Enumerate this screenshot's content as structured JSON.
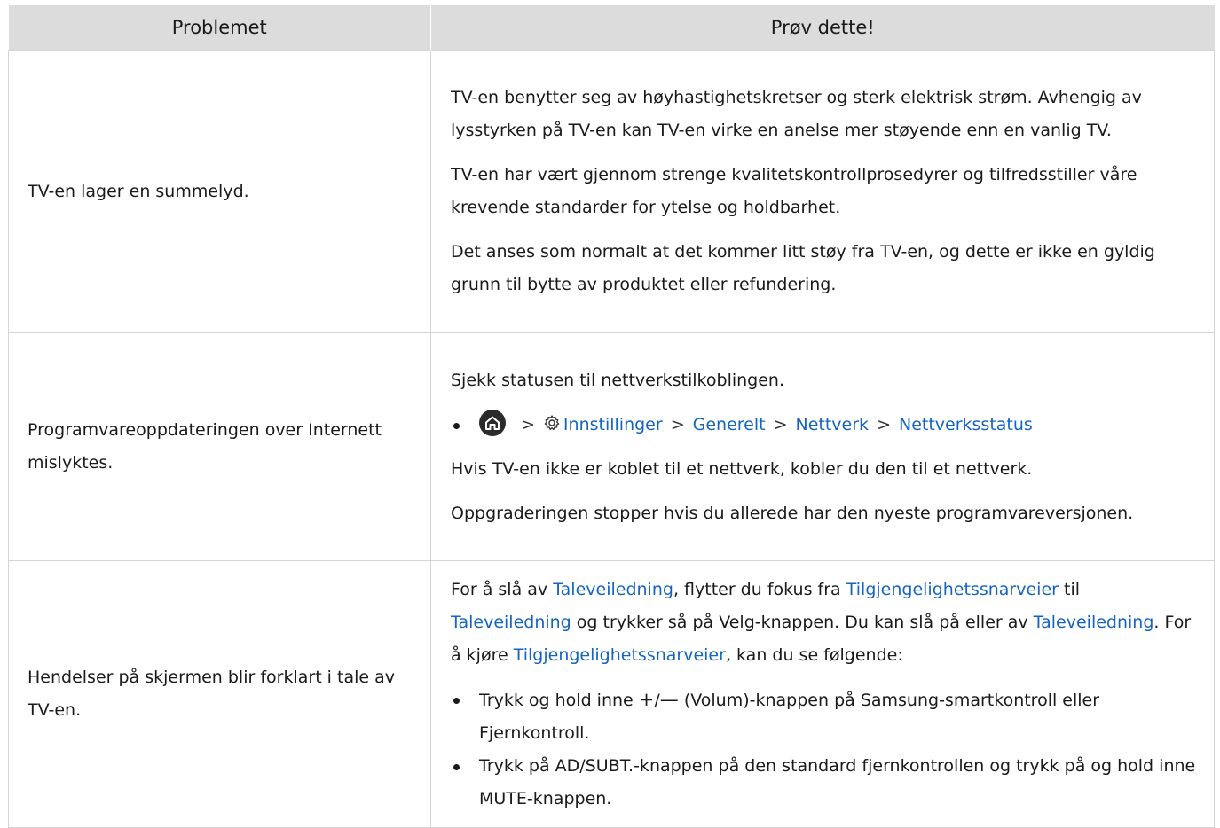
{
  "table": {
    "headers": [
      "Problemet",
      "Prøv dette!"
    ],
    "rows": [
      {
        "problem": "TV-en lager en summelyd.",
        "solution": {
          "p1": "TV-en benytter seg av høyhastighetskretser og sterk elektrisk strøm. Avhengig av lysstyrken på TV-en kan TV-en virke en anelse mer støyende enn en vanlig TV.",
          "p2": "TV-en har vært gjennom strenge kvalitetskontrollprosedyrer og tilfredsstiller våre krevende standarder for ytelse og holdbarhet.",
          "p3": "Det anses som normalt at det kommer litt støy fra TV-en, og dette er ikke en gyldig grunn til bytte av produktet eller refundering."
        }
      },
      {
        "problem": "Programvareoppdateringen over Internett mislyktes.",
        "solution": {
          "p1": "Sjekk statusen til nettverkstilkoblingen.",
          "path": {
            "home_icon": "home-icon",
            "settings_icon": "gear-icon",
            "separator": ">",
            "items": [
              "Innstillinger",
              "Generelt",
              "Nettverk",
              "Nettverksstatus"
            ]
          },
          "p2": "Hvis TV-en ikke er koblet til et nettverk, kobler du den til et nettverk.",
          "p3": "Oppgraderingen stopper hvis du allerede har den nyeste programvareversjonen."
        }
      },
      {
        "problem": "Hendelser på skjermen blir forklart i tale av TV-en.",
        "solution": {
          "intro": {
            "t1": "For å slå av ",
            "l1": "Taleveiledning",
            "t2": ", flytter du fokus fra ",
            "l2": "Tilgjengelighetssnarveier",
            "t3": " til ",
            "l3": "Taleveiledning",
            "t4": " og trykker så på Velg-knappen. Du kan slå på eller av ",
            "l4": "Taleveiledning",
            "t5": ". For å kjøre ",
            "l5": "Tilgjengelighetssnarveier",
            "t6": ", kan du se følgende:"
          },
          "bullet1": {
            "pre": "Trykk og hold inne ",
            "plus": "+",
            "slash": "/",
            "minus": "—",
            "post": " (Volum)-knappen på Samsung-smartkontroll eller Fjernkontroll."
          },
          "bullet2": "Trykk på AD/SUBT.-knappen på den standard fjernkontrollen og trykk på og hold inne MUTE-knappen."
        }
      }
    ]
  },
  "colors": {
    "header_bg": "#dcdcdc",
    "border": "#d4d4d4",
    "link": "#1565c0",
    "text": "#1a1a1a"
  }
}
